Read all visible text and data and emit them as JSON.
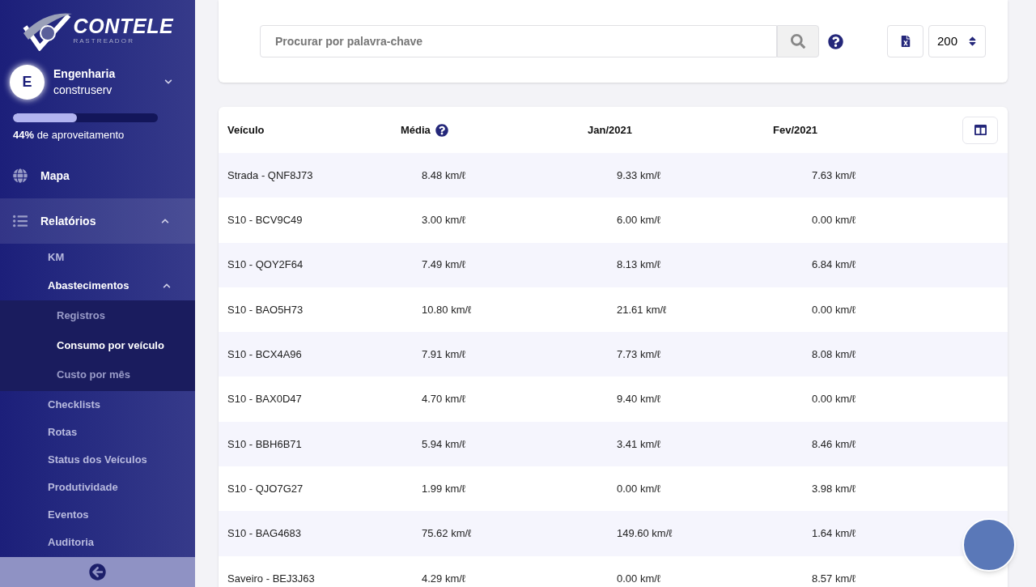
{
  "sidebar": {
    "logo": {
      "name": "CONTELE",
      "tagline": "R A S T R E A D O R"
    },
    "account": {
      "initial": "E",
      "name": "Engenharia",
      "company": "construserv",
      "expanded": false
    },
    "usage": {
      "level": 0.44,
      "text": "**44%** de aproveitamento"
    },
    "nav": [
      {
        "label": "Mapa"
      },
      {
        "label": "Relatórios",
        "expanded": true,
        "children": [
          {
            "label": "KM"
          },
          {
            "label": "Abastecimentos",
            "expanded": true,
            "children": [
              {
                "label": "Registros",
                "selected": false
              },
              {
                "label": "Consumo por veículo",
                "selected": true
              },
              {
                "label": "Custo por mês",
                "selected": false
              }
            ]
          },
          {
            "label": "Checklists"
          },
          {
            "label": "Rotas"
          },
          {
            "label": "Status dos Veículos"
          },
          {
            "label": "Produtividade"
          },
          {
            "label": "Eventos"
          },
          {
            "label": "Auditoria"
          }
        ]
      }
    ]
  },
  "toolbar": {
    "search": {
      "placeholder": "Procurar por palavra-chave"
    },
    "page_size": "200"
  },
  "table": {
    "columns": [
      {
        "label": "Veículo",
        "help": false
      },
      {
        "label": "Média",
        "help": true
      },
      {
        "label": "Jan/2021",
        "help": false
      },
      {
        "label": "Fev/2021",
        "help": false
      }
    ],
    "rows": [
      [
        "Strada - QNF8J73",
        "8.48 km/ℓ",
        "9.33 km/ℓ",
        "7.63 km/ℓ"
      ],
      [
        "S10 - BCV9C49",
        "3.00 km/ℓ",
        "6.00 km/ℓ",
        "0.00 km/ℓ"
      ],
      [
        "S10 - QOY2F64",
        "7.49 km/ℓ",
        "8.13 km/ℓ",
        "6.84 km/ℓ"
      ],
      [
        "S10 - BAO5H73",
        "10.80 km/ℓ",
        "21.61 km/ℓ",
        "0.00 km/ℓ"
      ],
      [
        "S10 - BCX4A96",
        "7.91 km/ℓ",
        "7.73 km/ℓ",
        "8.08 km/ℓ"
      ],
      [
        "S10 - BAX0D47",
        "4.70 km/ℓ",
        "9.40 km/ℓ",
        "0.00 km/ℓ"
      ],
      [
        "S10 - BBH6B71",
        "5.94 km/ℓ",
        "3.41 km/ℓ",
        "8.46 km/ℓ"
      ],
      [
        "S10 - QJO7G27",
        "1.99 km/ℓ",
        "0.00 km/ℓ",
        "3.98 km/ℓ"
      ],
      [
        "S10 - BAG4683",
        "75.62 km/ℓ",
        "149.60 km/ℓ",
        "1.64 km/ℓ"
      ],
      [
        "Saveiro - BEJ3J63",
        "4.29 km/ℓ",
        "0.00 km/ℓ",
        "8.57 km/ℓ"
      ]
    ]
  }
}
